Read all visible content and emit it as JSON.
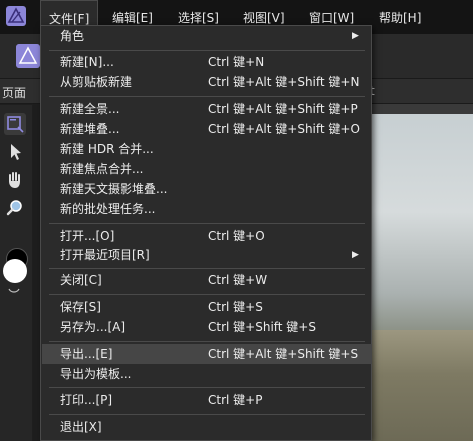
{
  "menubar": {
    "items": [
      {
        "label": "文件[F]"
      },
      {
        "label": "编辑[E]"
      },
      {
        "label": "选择[S]"
      },
      {
        "label": "视图[V]"
      },
      {
        "label": "窗口[W]"
      },
      {
        "label": "帮助[H]"
      }
    ]
  },
  "tabs": {
    "page": "页面",
    "partial": "t"
  },
  "file_menu": {
    "items": [
      {
        "label": "角色",
        "shortcut": "",
        "submenu": true
      },
      {
        "label": "新建[N]...",
        "shortcut": "Ctrl 键+N"
      },
      {
        "label": "从剪贴板新建",
        "shortcut": "Ctrl 键+Alt 键+Shift 键+N"
      },
      {
        "label": "新建全景...",
        "shortcut": "Ctrl 键+Alt 键+Shift 键+P"
      },
      {
        "label": "新建堆叠...",
        "shortcut": "Ctrl 键+Alt 键+Shift 键+O"
      },
      {
        "label": "新建 HDR 合并...",
        "shortcut": ""
      },
      {
        "label": "新建焦点合并...",
        "shortcut": ""
      },
      {
        "label": "新建天文摄影堆叠...",
        "shortcut": ""
      },
      {
        "label": "新的批处理任务...",
        "shortcut": ""
      },
      {
        "label": "打开...[O]",
        "shortcut": "Ctrl 键+O"
      },
      {
        "label": "打开最近项目[R]",
        "shortcut": "",
        "submenu": true
      },
      {
        "label": "关闭[C]",
        "shortcut": "Ctrl 键+W"
      },
      {
        "label": "保存[S]",
        "shortcut": "Ctrl 键+S"
      },
      {
        "label": "另存为...[A]",
        "shortcut": "Ctrl 键+Shift 键+S"
      },
      {
        "label": "导出...[E]",
        "shortcut": "Ctrl 键+Alt 键+Shift 键+S",
        "highlighted": true
      },
      {
        "label": "导出为模板...",
        "shortcut": ""
      },
      {
        "label": "打印...[P]",
        "shortcut": "Ctrl 键+P"
      },
      {
        "label": "退出[X]",
        "shortcut": ""
      }
    ],
    "submenu_arrow": "▶"
  },
  "colors": {
    "accent": "#7b7bc4",
    "menu_bg": "#2b2b2b",
    "highlight": "#464646"
  }
}
